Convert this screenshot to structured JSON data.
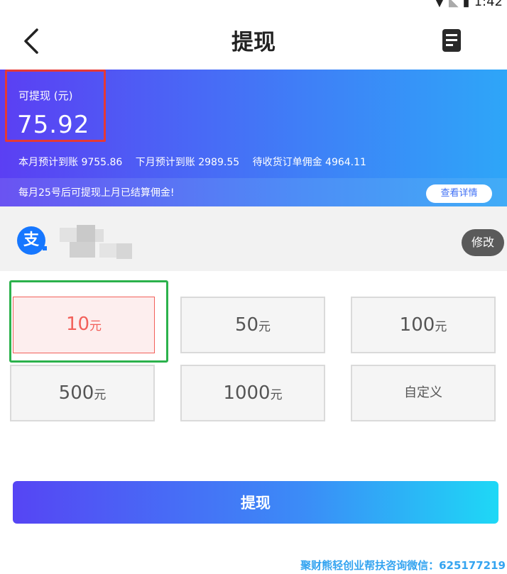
{
  "status_bar": {
    "time": "1:42"
  },
  "nav": {
    "title": "提现"
  },
  "balance": {
    "label": "可提现 (元)",
    "amount": "75.92",
    "stats": [
      "本月预计到账 9755.86",
      "下月预计到账 2989.55",
      "待收货订单佣金 4964.11"
    ]
  },
  "notice": {
    "text": "每月25号后可提现上月已结算佣金!",
    "detail_label": "查看详情"
  },
  "account": {
    "icon_glyph": "支",
    "edit_label": "修改"
  },
  "amount_unit": "元",
  "amounts": [
    {
      "value": "10",
      "selected": true
    },
    {
      "value": "50"
    },
    {
      "value": "100"
    },
    {
      "value": "500"
    },
    {
      "value": "1000"
    }
  ],
  "custom_label": "自定义",
  "withdraw_label": "提现",
  "watermark": "聚财熊轻创业帮扶咨询微信：625177219",
  "colors": {
    "accent_start": "#5645f4",
    "accent_end": "#1ed8f6",
    "selected": "#f2605a",
    "alipay": "#1677ff"
  }
}
